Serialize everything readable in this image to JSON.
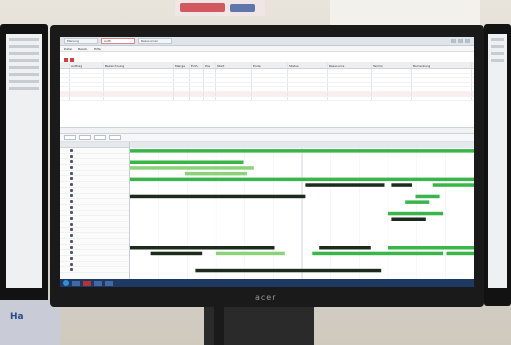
{
  "scene": {
    "monitor_brand": "acer",
    "side_sign": "Ha"
  },
  "app": {
    "tabs": [
      "Planung",
      "Auftr",
      "Ressourcen"
    ],
    "menu": [
      "Datei",
      "Bearb.",
      "Hilfe"
    ]
  },
  "order_grid": {
    "columns": [
      "",
      "Auftrag",
      "Bezeichnung",
      "Menge",
      "Einh.",
      "Pos",
      "Start",
      "Ende",
      "Status",
      "Ressource",
      "Termin",
      "Bemerkung"
    ],
    "rows": [
      {
        "cells": [
          "",
          "",
          "",
          "",
          "",
          "",
          "",
          "",
          "",
          "",
          "",
          ""
        ],
        "highlight": false
      },
      {
        "cells": [
          "",
          "",
          "",
          "",
          "",
          "",
          "",
          "",
          "",
          "",
          "",
          ""
        ],
        "highlight": false
      },
      {
        "cells": [
          "",
          "",
          "",
          "",
          "",
          "",
          "",
          "",
          "",
          "",
          "",
          ""
        ],
        "highlight": false
      },
      {
        "cells": [
          "",
          "",
          "",
          "",
          "",
          "",
          "",
          "",
          "",
          "",
          "",
          ""
        ],
        "highlight": false
      },
      {
        "cells": [
          "",
          "",
          "",
          "",
          "",
          "",
          "",
          "",
          "",
          "",
          "",
          ""
        ],
        "highlight": false
      },
      {
        "cells": [
          "",
          "",
          "",
          "",
          "",
          "",
          "",
          "",
          "",
          "",
          "",
          ""
        ],
        "highlight": true
      },
      {
        "cells": [
          "",
          "",
          "",
          "",
          "",
          "",
          "",
          "",
          "",
          "",
          "",
          ""
        ],
        "highlight": false
      }
    ]
  },
  "gantt": {
    "toolbar": [
      "",
      "",
      "",
      ""
    ],
    "tree_header": "",
    "tree_rows": [
      {
        "label": "",
        "highlight": false
      },
      {
        "label": "",
        "highlight": true
      },
      {
        "label": "",
        "highlight": true
      },
      {
        "label": "",
        "highlight": true
      },
      {
        "label": "",
        "highlight": false
      },
      {
        "label": "",
        "highlight": false
      },
      {
        "label": "",
        "highlight": false
      },
      {
        "label": "",
        "highlight": false
      },
      {
        "label": "",
        "highlight": false
      },
      {
        "label": "",
        "highlight": false
      },
      {
        "label": "",
        "highlight": false
      },
      {
        "label": "",
        "highlight": false
      },
      {
        "label": "",
        "highlight": false
      },
      {
        "label": "",
        "highlight": false
      },
      {
        "label": "",
        "highlight": false
      },
      {
        "label": "",
        "highlight": true
      },
      {
        "label": "",
        "highlight": true
      },
      {
        "label": "",
        "highlight": false
      },
      {
        "label": "",
        "highlight": true
      },
      {
        "label": "",
        "highlight": true
      },
      {
        "label": "",
        "highlight": false
      },
      {
        "label": "",
        "highlight": false
      }
    ],
    "colors": {
      "bar_green": "#39b54a",
      "bar_light": "#8cd27a",
      "bar_dark": "#1d2b1d"
    },
    "bars": [
      {
        "row": 0,
        "start": 0.0,
        "end": 1.0,
        "color": "bar_green",
        "label": ""
      },
      {
        "row": 2,
        "start": 0.0,
        "end": 0.33,
        "color": "bar_green",
        "label": ""
      },
      {
        "row": 3,
        "start": 0.0,
        "end": 0.36,
        "color": "bar_light",
        "label": ""
      },
      {
        "row": 4,
        "start": 0.16,
        "end": 0.34,
        "color": "bar_light",
        "label": ""
      },
      {
        "row": 5,
        "start": 0.0,
        "end": 1.0,
        "color": "bar_green",
        "label": ""
      },
      {
        "row": 6,
        "start": 0.51,
        "end": 0.74,
        "color": "bar_dark",
        "label": ""
      },
      {
        "row": 6,
        "start": 0.76,
        "end": 0.82,
        "color": "bar_dark",
        "label": ""
      },
      {
        "row": 6,
        "start": 0.88,
        "end": 1.0,
        "color": "bar_green",
        "label": ""
      },
      {
        "row": 8,
        "start": 0.0,
        "end": 0.51,
        "color": "bar_dark",
        "label": ""
      },
      {
        "row": 8,
        "start": 0.83,
        "end": 0.9,
        "color": "bar_green",
        "label": ""
      },
      {
        "row": 9,
        "start": 0.8,
        "end": 0.87,
        "color": "bar_green",
        "label": ""
      },
      {
        "row": 11,
        "start": 0.75,
        "end": 0.91,
        "color": "bar_green",
        "label": ""
      },
      {
        "row": 12,
        "start": 0.76,
        "end": 0.86,
        "color": "bar_dark",
        "label": ""
      },
      {
        "row": 17,
        "start": 0.0,
        "end": 0.42,
        "color": "bar_dark",
        "label": ""
      },
      {
        "row": 17,
        "start": 0.55,
        "end": 0.7,
        "color": "bar_dark",
        "label": ""
      },
      {
        "row": 17,
        "start": 0.75,
        "end": 1.0,
        "color": "bar_green",
        "label": ""
      },
      {
        "row": 18,
        "start": 0.06,
        "end": 0.21,
        "color": "bar_dark",
        "label": ""
      },
      {
        "row": 18,
        "start": 0.25,
        "end": 0.45,
        "color": "bar_light",
        "label": ""
      },
      {
        "row": 18,
        "start": 0.53,
        "end": 0.91,
        "color": "bar_green",
        "label": ""
      },
      {
        "row": 18,
        "start": 0.92,
        "end": 1.0,
        "color": "bar_green",
        "label": ""
      },
      {
        "row": 21,
        "start": 0.19,
        "end": 0.73,
        "color": "bar_dark",
        "label": ""
      }
    ],
    "today_marker": 0.5
  }
}
